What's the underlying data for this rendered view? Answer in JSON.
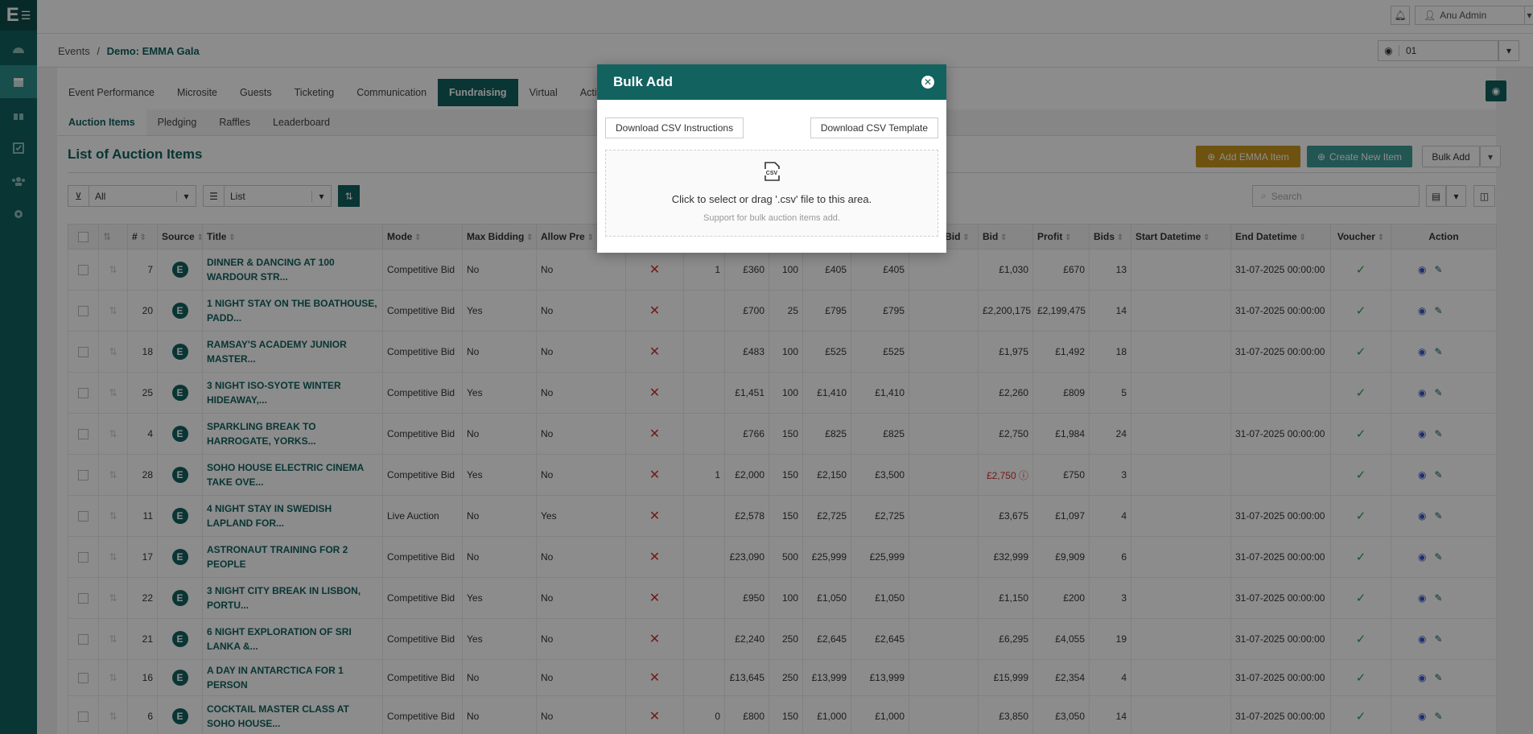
{
  "sidebar": {
    "logo": "E",
    "icons": [
      "dashboard-icon",
      "calendar-icon",
      "gift-icon",
      "check-square-icon",
      "users-icon",
      "gear-icon"
    ]
  },
  "topbar": {
    "user": "Anu Admin"
  },
  "breadcrumb": {
    "root": "Events",
    "separator": "/",
    "current": "Demo: EMMA Gala"
  },
  "event_selector": {
    "value": "01"
  },
  "tabs": [
    "Event Performance",
    "Microsite",
    "Guests",
    "Ticketing",
    "Communication",
    "Fundraising",
    "Virtual",
    "Activity"
  ],
  "active_tab": "Fundraising",
  "subtabs": [
    "Auction Items",
    "Pledging",
    "Raffles",
    "Leaderboard"
  ],
  "page_title": "List of Auction Items",
  "actions": {
    "add_emma": "Add EMMA Item",
    "create_new": "Create New Item",
    "bulk_add": "Bulk Add"
  },
  "filters": {
    "status": "All",
    "view": "List",
    "search_placeholder": "Search"
  },
  "colors": {
    "primary": "#12625f",
    "gold": "#c9961c",
    "danger": "#d32f2f",
    "success": "#2e9d49"
  },
  "table": {
    "columns": [
      "",
      "",
      "#",
      "Source",
      "Title",
      "Mode",
      "Max Bidding",
      "Allow Pre",
      "",
      "",
      "",
      "",
      "",
      "",
      "Target Bid",
      "Bid",
      "Profit",
      "Bids",
      "Start Datetime",
      "End Datetime",
      "Voucher",
      "Action"
    ],
    "rows": [
      {
        "id": "7",
        "title": "DINNER & DANCING AT 100 WARDOUR STR...",
        "mode": "Competitive Bid",
        "max": "No",
        "allow": "No",
        "c1": "1",
        "c2": "£360",
        "c3": "100",
        "c4": "£405",
        "c5": "£405",
        "bid": "£1,030",
        "profit": "£670",
        "bids": "13",
        "start": "",
        "end": "31-07-2025 00:00:00"
      },
      {
        "id": "20",
        "title": "1 NIGHT STAY ON THE BOATHOUSE, PADD...",
        "mode": "Competitive Bid",
        "max": "Yes",
        "allow": "No",
        "c1": "",
        "c2": "£700",
        "c3": "25",
        "c4": "£795",
        "c5": "£795",
        "bid": "£2,200,175",
        "profit": "£2,199,475",
        "bids": "14",
        "start": "",
        "end": "31-07-2025 00:00:00"
      },
      {
        "id": "18",
        "title": "RAMSAY'S ACADEMY JUNIOR MASTER...",
        "mode": "Competitive Bid",
        "max": "No",
        "allow": "No",
        "c1": "",
        "c2": "£483",
        "c3": "100",
        "c4": "£525",
        "c5": "£525",
        "bid": "£1,975",
        "profit": "£1,492",
        "bids": "18",
        "start": "",
        "end": "31-07-2025 00:00:00"
      },
      {
        "id": "25",
        "title": "3 NIGHT ISO-SYOTE WINTER HIDEAWAY,...",
        "mode": "Competitive Bid",
        "max": "Yes",
        "allow": "No",
        "c1": "",
        "c2": "£1,451",
        "c3": "100",
        "c4": "£1,410",
        "c5": "£1,410",
        "bid": "£2,260",
        "profit": "£809",
        "bids": "5",
        "start": "",
        "end": ""
      },
      {
        "id": "4",
        "title": "SPARKLING BREAK TO HARROGATE, YORKS...",
        "mode": "Competitive Bid",
        "max": "No",
        "allow": "No",
        "c1": "",
        "c2": "£766",
        "c3": "150",
        "c4": "£825",
        "c5": "£825",
        "bid": "£2,750",
        "profit": "£1,984",
        "bids": "24",
        "start": "",
        "end": "31-07-2025 00:00:00"
      },
      {
        "id": "28",
        "title": "SOHO HOUSE ELECTRIC CINEMA TAKE OVE...",
        "mode": "Competitive Bid",
        "max": "Yes",
        "allow": "No",
        "c1": "1",
        "c2": "£2,000",
        "c3": "150",
        "c4": "£2,150",
        "c5": "£3,500",
        "bid": "£2,750",
        "bid_alert": true,
        "profit": "£750",
        "bids": "3",
        "start": "",
        "end": ""
      },
      {
        "id": "11",
        "title": "4 NIGHT STAY IN SWEDISH LAPLAND FOR...",
        "mode": "Live Auction",
        "max": "No",
        "allow": "Yes",
        "c1": "",
        "c2": "£2,578",
        "c3": "150",
        "c4": "£2,725",
        "c5": "£2,725",
        "bid": "£3,675",
        "profit": "£1,097",
        "bids": "4",
        "start": "",
        "end": "31-07-2025 00:00:00"
      },
      {
        "id": "17",
        "title": "ASTRONAUT TRAINING FOR 2 PEOPLE",
        "mode": "Competitive Bid",
        "max": "No",
        "allow": "No",
        "c1": "",
        "c2": "£23,090",
        "c3": "500",
        "c4": "£25,999",
        "c5": "£25,999",
        "bid": "£32,999",
        "profit": "£9,909",
        "bids": "6",
        "start": "",
        "end": "31-07-2025 00:00:00"
      },
      {
        "id": "22",
        "title": "3 NIGHT CITY BREAK IN LISBON, PORTU...",
        "mode": "Competitive Bid",
        "max": "Yes",
        "allow": "No",
        "c1": "",
        "c2": "£950",
        "c3": "100",
        "c4": "£1,050",
        "c5": "£1,050",
        "bid": "£1,150",
        "profit": "£200",
        "bids": "3",
        "start": "",
        "end": "31-07-2025 00:00:00"
      },
      {
        "id": "21",
        "title": "6 NIGHT EXPLORATION OF SRI LANKA &...",
        "mode": "Competitive Bid",
        "max": "Yes",
        "allow": "No",
        "c1": "",
        "c2": "£2,240",
        "c3": "250",
        "c4": "£2,645",
        "c5": "£2,645",
        "bid": "£6,295",
        "profit": "£4,055",
        "bids": "19",
        "start": "",
        "end": "31-07-2025 00:00:00"
      },
      {
        "id": "16",
        "title": "A DAY IN ANTARCTICA FOR 1 PERSON",
        "mode": "Competitive Bid",
        "max": "No",
        "allow": "No",
        "c1": "",
        "c2": "£13,645",
        "c3": "250",
        "c4": "£13,999",
        "c5": "£13,999",
        "bid": "£15,999",
        "profit": "£2,354",
        "bids": "4",
        "start": "",
        "end": "31-07-2025 00:00:00",
        "short": true
      },
      {
        "id": "6",
        "title": "COCKTAIL MASTER CLASS AT SOHO HOUSE...",
        "mode": "Competitive Bid",
        "max": "No",
        "allow": "No",
        "c1": "0",
        "c2": "£800",
        "c3": "150",
        "c4": "£1,000",
        "c5": "£1,000",
        "bid": "£3,850",
        "profit": "£3,050",
        "bids": "14",
        "start": "",
        "end": "31-07-2025 00:00:00"
      }
    ]
  },
  "modal": {
    "title": "Bulk Add",
    "btn_instructions": "Download CSV Instructions",
    "btn_template": "Download CSV Template",
    "drop_icon": "CSV",
    "drop_text": "Click to select or drag '.csv' file to this area.",
    "drop_hint": "Support for bulk auction items add."
  }
}
